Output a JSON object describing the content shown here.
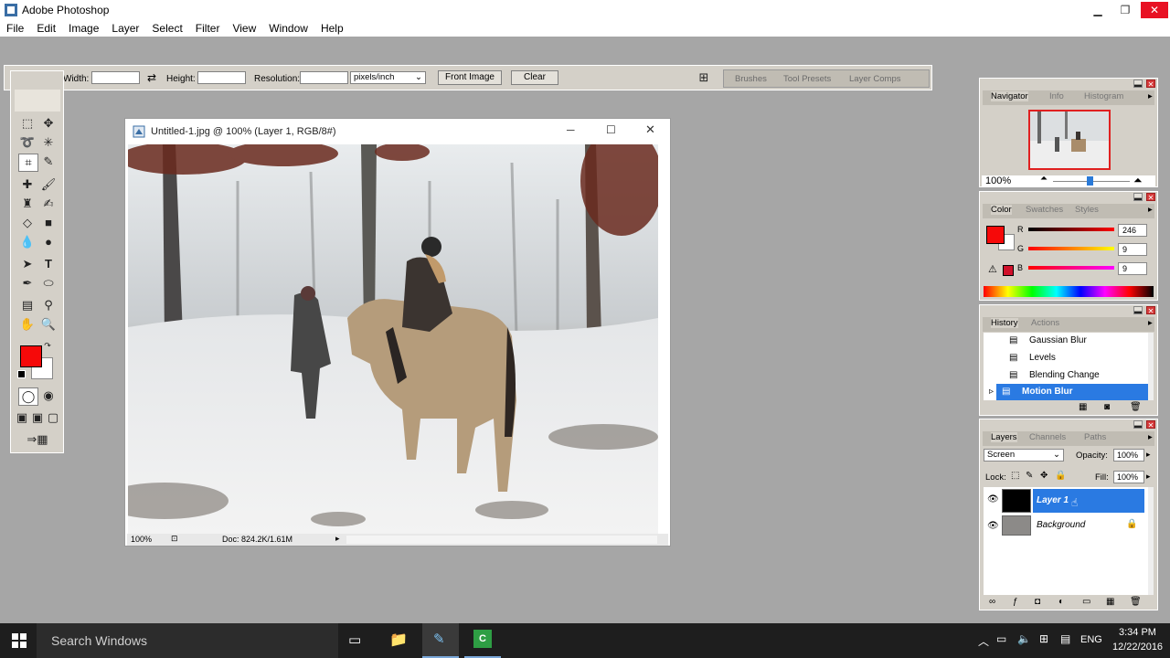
{
  "app": {
    "title": "Adobe Photoshop"
  },
  "menu": [
    "File",
    "Edit",
    "Image",
    "Layer",
    "Select",
    "Filter",
    "View",
    "Window",
    "Help"
  ],
  "options": {
    "width_label": "Width:",
    "height_label": "Height:",
    "resolution_label": "Resolution:",
    "units": "pixels/inch",
    "front_image": "Front Image",
    "clear": "Clear",
    "well_tabs": [
      "Brushes",
      "Tool Presets",
      "Layer Comps"
    ]
  },
  "document": {
    "title": "Untitled-1.jpg @ 100% (Layer 1, RGB/8#)",
    "zoom": "100%",
    "doc_size": "Doc: 824.2K/1.61M"
  },
  "navigator": {
    "tabs": [
      "Navigator",
      "Info",
      "Histogram"
    ],
    "zoom": "100%"
  },
  "color": {
    "tabs": [
      "Color",
      "Swatches",
      "Styles"
    ],
    "r_label": "R",
    "g_label": "G",
    "b_label": "B",
    "r": "246",
    "g": "9",
    "b": "9",
    "foreground": "#f60909"
  },
  "history": {
    "tabs": [
      "History",
      "Actions"
    ],
    "items": [
      "Gaussian Blur",
      "Levels",
      "Blending Change",
      "Motion Blur"
    ]
  },
  "layers": {
    "tabs": [
      "Layers",
      "Channels",
      "Paths"
    ],
    "blend_mode": "Screen",
    "opacity_label": "Opacity:",
    "opacity": "100%",
    "lock_label": "Lock:",
    "fill_label": "Fill:",
    "fill": "100%",
    "items": [
      "Layer 1",
      "Background"
    ]
  },
  "taskbar": {
    "search": "Search Windows",
    "lang": "ENG",
    "time": "3:34 PM",
    "date": "12/22/2016"
  }
}
